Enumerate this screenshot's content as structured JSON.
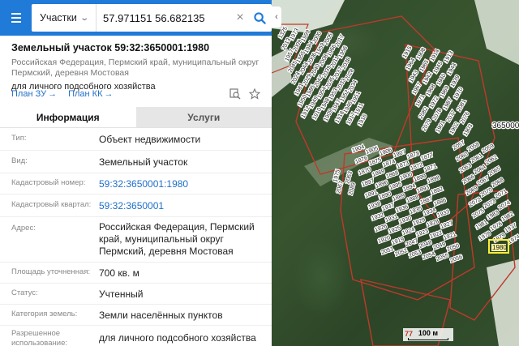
{
  "search": {
    "type_label": "Участки",
    "query": "57.971151 56.682135"
  },
  "parcel": {
    "title": "Земельный участок 59:32:3650001:1980",
    "address_short": "Российская Федерация, Пермский край, муниципальный округ Пермский, деревня Мостовая",
    "purpose": "для личного подсобного хозяйства",
    "link_plan_zu": "План ЗУ",
    "link_plan_kk": "План КК"
  },
  "tabs": {
    "info": "Информация",
    "services": "Услуги"
  },
  "fields": [
    {
      "label": "Тип:",
      "value": "Объект недвижимости"
    },
    {
      "label": "Вид:",
      "value": "Земельный участок"
    },
    {
      "label": "Кадастровый номер:",
      "value": "59:32:3650001:1980"
    },
    {
      "label": "Кадастровый квартал:",
      "value": "59:32:3650001"
    },
    {
      "label": "Адрес:",
      "value": "Российская Федерация, Пермский край, муниципальный округ Пермский, деревня Мостовая"
    },
    {
      "label": "Площадь уточненная:",
      "value": "700 кв. м"
    },
    {
      "label": "Статус:",
      "value": "Учтенный"
    },
    {
      "label": "Категория земель:",
      "value": "Земли населённых пунктов"
    },
    {
      "label": "Разрешенное использование:",
      "value": "для личного подсобного хозяйства"
    }
  ],
  "map": {
    "quarter_label": "365000",
    "scale_label": "100 м",
    "selected_parcel": "1980",
    "corner_label": "77",
    "parcel_numbers": [
      "1325",
      "1973",
      "1999",
      "2000",
      "2005",
      "2017",
      "2013",
      "2009",
      "1984",
      "1959",
      "1966",
      "1956",
      "1957",
      "1955",
      "2006",
      "2008",
      "2011",
      "2038",
      "2045",
      "2044",
      "2040",
      "2039",
      "2037",
      "2028",
      "2024",
      "2029",
      "2042",
      "2035",
      "2033",
      "2034",
      "1981",
      "1985",
      "1954",
      "1953",
      "1952",
      "1951",
      "1950",
      "1949",
      "1948",
      "1947",
      "1946",
      "1911",
      "1912",
      "1910",
      "1909",
      "1918",
      "1917",
      "1916",
      "1915",
      "1908",
      "1914",
      "1913",
      "1964",
      "1965",
      "1945",
      "1944",
      "1943",
      "1942",
      "1940",
      "1939",
      "1967",
      "1968",
      "1969",
      "1970",
      "1971",
      "1972",
      "1987",
      "2081",
      "2082",
      "2078",
      "2077",
      "2076",
      "2079",
      "1901",
      "1902",
      "1903",
      "1904",
      "1905",
      "1906",
      "1907",
      "1878",
      "1877",
      "1876",
      "1875",
      "1874",
      "1873",
      "1872",
      "1871",
      "1870",
      "1869",
      "1868",
      "1900",
      "1899",
      "1898",
      "1897",
      "1896",
      "1895",
      "1894",
      "1893",
      "1892",
      "1891",
      "1890",
      "1889",
      "1888",
      "1887",
      "1886",
      "1938",
      "1937",
      "1936",
      "1935",
      "1934",
      "1933",
      "1932",
      "1931",
      "1930",
      "1929",
      "1928",
      "1927",
      "1926",
      "1925",
      "1924",
      "1923",
      "1922",
      "1921",
      "1920",
      "1919",
      "2047",
      "2048",
      "2049",
      "2050",
      "2051",
      "2052",
      "2053",
      "2054",
      "2055",
      "2056",
      "2057",
      "2058",
      "2059",
      "2060",
      "2061",
      "2062",
      "2063",
      "2064",
      "2065",
      "2066",
      "2067",
      "2068",
      "2069",
      "2070",
      "2071",
      "2072",
      "2073",
      "2074",
      "2075",
      "1983",
      "1982",
      "1981",
      "1976",
      "1977",
      "1978",
      "1979",
      "1974",
      "1975",
      "2063",
      "2067",
      "2089"
    ],
    "colors": {
      "parcel_border": "#c0392b",
      "label_bg": "#ffffff",
      "selected_bg": "#fff59d"
    }
  }
}
